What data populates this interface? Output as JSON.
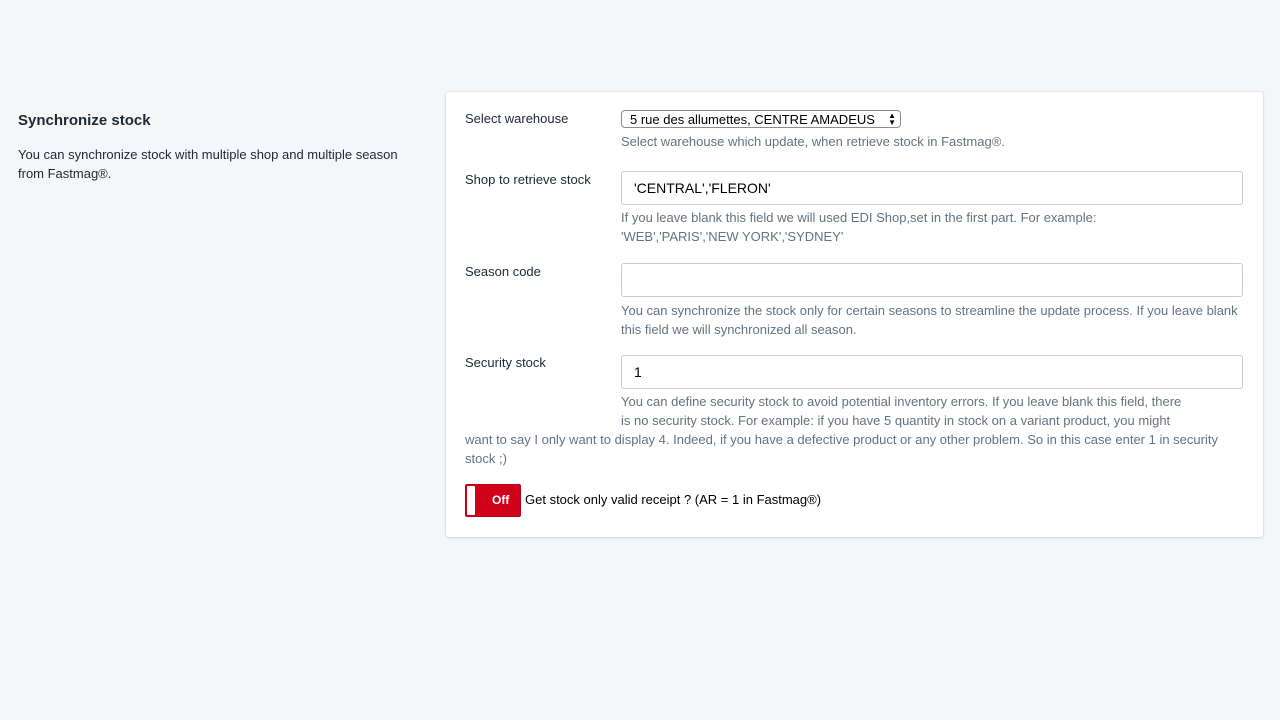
{
  "section": {
    "title": "Synchronize stock",
    "description": "You can synchronize stock with multiple shop and multiple season from Fastmag®."
  },
  "form": {
    "warehouse": {
      "label": "Select warehouse",
      "selected": "5 rue des allumettes, CENTRE AMADEUS",
      "help": "Select warehouse which update, when retrieve stock in Fastmag®."
    },
    "shop": {
      "label": "Shop to retrieve stock",
      "value": "'CENTRAL','FLERON'",
      "help": "If you leave blank this field we will used EDI Shop,set in the first part. For example: 'WEB','PARIS','NEW YORK','SYDNEY'"
    },
    "season": {
      "label": "Season code",
      "value": "",
      "help": "You can synchronize the stock only for certain seasons to streamline the update process. If you leave blank this field we will synchronized all season."
    },
    "security": {
      "label": "Security stock",
      "value": "1",
      "help_line1": "You can define security stock to avoid potential inventory errors. If you leave blank this field, there",
      "help_line2": "is no security stock. For example: if you have 5 quantity in stock on a variant product, you might",
      "help_rest": "want to say I only want to display 4. Indeed, if you have a defective product or any other problem. So in this case enter 1 in security stock ;)"
    },
    "valid_receipt": {
      "state": "Off",
      "label": "Get stock only valid receipt ? (AR = 1 in Fastmag®)"
    }
  },
  "colors": {
    "toggle_off": "#d0021b",
    "help_text": "#637381",
    "background": "#f4f6f8"
  }
}
